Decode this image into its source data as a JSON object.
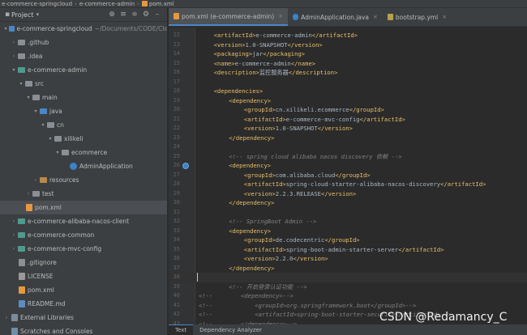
{
  "breadcrumb": {
    "project": "e-commerce-springcloud",
    "module": "e-commerce-admin",
    "file": "pom.xml"
  },
  "project_panel": {
    "title": "Project",
    "tree": [
      {
        "label": "e-commerce-springcloud",
        "extra": "~/Documents/CODE/Clo",
        "indent": 0,
        "arrow": "▾",
        "icon": "fold blue"
      },
      {
        "label": ".github",
        "indent": 1,
        "arrow": "›",
        "icon": "fold grey"
      },
      {
        "label": ".idea",
        "indent": 1,
        "arrow": "›",
        "icon": "fold grey"
      },
      {
        "label": "e-commerce-admin",
        "indent": 1,
        "arrow": "▾",
        "icon": "fold teal"
      },
      {
        "label": "src",
        "indent": 2,
        "arrow": "▾",
        "icon": "fold grey"
      },
      {
        "label": "main",
        "indent": 3,
        "arrow": "▾",
        "icon": "fold grey"
      },
      {
        "label": "java",
        "indent": 4,
        "arrow": "▾",
        "icon": "fold src"
      },
      {
        "label": "cn",
        "indent": 5,
        "arrow": "▾",
        "icon": "fold grey"
      },
      {
        "label": "xilikeli",
        "indent": 6,
        "arrow": "▾",
        "icon": "fold grey"
      },
      {
        "label": "ecommerce",
        "indent": 7,
        "arrow": "▾",
        "icon": "fold grey"
      },
      {
        "label": "AdminApplication",
        "indent": 8,
        "arrow": "",
        "icon": "filei cls"
      },
      {
        "label": "resources",
        "indent": 4,
        "arrow": "›",
        "icon": "fold orange"
      },
      {
        "label": "test",
        "indent": 3,
        "arrow": "›",
        "icon": "fold grey"
      },
      {
        "label": "pom.xml",
        "indent": 2,
        "arrow": "",
        "icon": "filei m",
        "selected": true
      },
      {
        "label": "e-commerce-alibaba-nacos-client",
        "indent": 1,
        "arrow": "›",
        "icon": "fold teal"
      },
      {
        "label": "e-commerce-common",
        "indent": 1,
        "arrow": "›",
        "icon": "fold teal"
      },
      {
        "label": "e-commerce-mvc-config",
        "indent": 1,
        "arrow": "›",
        "icon": "fold teal"
      },
      {
        "label": ".gitignore",
        "indent": 1,
        "arrow": "",
        "icon": "filei git"
      },
      {
        "label": "LICENSE",
        "indent": 1,
        "arrow": "",
        "icon": "filei lic"
      },
      {
        "label": "pom.xml",
        "indent": 1,
        "arrow": "",
        "icon": "filei m"
      },
      {
        "label": "README.md",
        "indent": 1,
        "arrow": "",
        "icon": "filei md"
      },
      {
        "label": "External Libraries",
        "indent": 0,
        "arrow": "›",
        "icon": "filei lib"
      },
      {
        "label": "Scratches and Consoles",
        "indent": 0,
        "arrow": "",
        "icon": "filei scr"
      }
    ]
  },
  "tabs": [
    {
      "label": "pom.xml (e-commerce-admin)",
      "icon": "m",
      "active": true
    },
    {
      "label": "AdminApplication.java",
      "icon": "j",
      "active": false
    },
    {
      "label": "bootstrap.yml",
      "icon": "y",
      "active": false
    }
  ],
  "code_lines": [
    {
      "n": "12",
      "indent": 2,
      "parts": [
        [
          "tag",
          "<artifactId>"
        ],
        [
          "txt",
          "e-commerce-admin"
        ],
        [
          "tag",
          "</artifactId>"
        ]
      ]
    },
    {
      "n": "13",
      "indent": 2,
      "parts": [
        [
          "tag",
          "<version>"
        ],
        [
          "txt",
          "1.0-SNAPSHOT"
        ],
        [
          "tag",
          "</version>"
        ]
      ]
    },
    {
      "n": "14",
      "indent": 2,
      "parts": [
        [
          "tag",
          "<packaging>"
        ],
        [
          "txt",
          "jar"
        ],
        [
          "tag",
          "</packaging>"
        ]
      ]
    },
    {
      "n": "15",
      "indent": 2,
      "parts": [
        [
          "tag",
          "<name>"
        ],
        [
          "txt",
          "e-commerce-admin"
        ],
        [
          "tag",
          "</name>"
        ]
      ]
    },
    {
      "n": "16",
      "indent": 2,
      "parts": [
        [
          "tag",
          "<description>"
        ],
        [
          "txt",
          "监控服务器"
        ],
        [
          "tag",
          "</description>"
        ]
      ]
    },
    {
      "n": "17",
      "indent": 0,
      "parts": []
    },
    {
      "n": "18",
      "indent": 2,
      "parts": [
        [
          "tag",
          "<dependencies>"
        ]
      ]
    },
    {
      "n": "19",
      "indent": 4,
      "parts": [
        [
          "tag",
          "<dependency>"
        ]
      ]
    },
    {
      "n": "20",
      "indent": 6,
      "parts": [
        [
          "tag",
          "<groupId>"
        ],
        [
          "txt",
          "cn.xilikeli.ecommerce"
        ],
        [
          "tag",
          "</groupId>"
        ]
      ]
    },
    {
      "n": "21",
      "indent": 6,
      "parts": [
        [
          "tag",
          "<artifactId>"
        ],
        [
          "txt",
          "e-commerce-mvc-config"
        ],
        [
          "tag",
          "</artifactId>"
        ]
      ]
    },
    {
      "n": "22",
      "indent": 6,
      "parts": [
        [
          "tag",
          "<version>"
        ],
        [
          "txt",
          "1.0-SNAPSHOT"
        ],
        [
          "tag",
          "</version>"
        ]
      ]
    },
    {
      "n": "23",
      "indent": 4,
      "parts": [
        [
          "tag",
          "</dependency>"
        ]
      ]
    },
    {
      "n": "24",
      "indent": 0,
      "parts": []
    },
    {
      "n": "25",
      "indent": 4,
      "parts": [
        [
          "cmt",
          "<!-- spring cloud alibaba nacos discovery 依赖 -->"
        ]
      ]
    },
    {
      "n": "26",
      "indent": 4,
      "parts": [
        [
          "tag",
          "<dependency>"
        ]
      ],
      "marker": true
    },
    {
      "n": "27",
      "indent": 6,
      "parts": [
        [
          "tag",
          "<groupId>"
        ],
        [
          "txt",
          "com.alibaba.cloud"
        ],
        [
          "tag",
          "</groupId>"
        ]
      ]
    },
    {
      "n": "28",
      "indent": 6,
      "parts": [
        [
          "tag",
          "<artifactId>"
        ],
        [
          "txt",
          "spring-cloud-starter-alibaba-nacos-discovery"
        ],
        [
          "tag",
          "</artifactId>"
        ]
      ]
    },
    {
      "n": "29",
      "indent": 6,
      "parts": [
        [
          "tag",
          "<version>"
        ],
        [
          "txt",
          "2.2.3.RELEASE"
        ],
        [
          "tag",
          "</version>"
        ]
      ]
    },
    {
      "n": "30",
      "indent": 4,
      "parts": [
        [
          "tag",
          "</dependency>"
        ]
      ]
    },
    {
      "n": "31",
      "indent": 0,
      "parts": []
    },
    {
      "n": "32",
      "indent": 4,
      "parts": [
        [
          "cmt",
          "<!-- SpringBoot Admin -->"
        ]
      ]
    },
    {
      "n": "33",
      "indent": 4,
      "parts": [
        [
          "tag",
          "<dependency>"
        ]
      ]
    },
    {
      "n": "34",
      "indent": 6,
      "parts": [
        [
          "tag",
          "<groupId>"
        ],
        [
          "txt",
          "de.codecentric"
        ],
        [
          "tag",
          "</groupId>"
        ]
      ]
    },
    {
      "n": "35",
      "indent": 6,
      "parts": [
        [
          "tag",
          "<artifactId>"
        ],
        [
          "txt",
          "spring-boot-admin-starter-server"
        ],
        [
          "tag",
          "</artifactId>"
        ]
      ]
    },
    {
      "n": "36",
      "indent": 6,
      "parts": [
        [
          "tag",
          "<version>"
        ],
        [
          "txt",
          "2.2.0"
        ],
        [
          "tag",
          "</version>"
        ]
      ]
    },
    {
      "n": "37",
      "indent": 4,
      "parts": [
        [
          "tag",
          "</dependency>"
        ]
      ]
    },
    {
      "n": "38",
      "indent": 0,
      "parts": [],
      "current": true
    },
    {
      "n": "39",
      "indent": 4,
      "parts": [
        [
          "cmt",
          "<!-- 开启登录认证功能 -->"
        ]
      ]
    },
    {
      "n": "40",
      "indent": 0,
      "parts": [
        [
          "cmt",
          "<!--        <dependency>-->"
        ]
      ]
    },
    {
      "n": "41",
      "indent": 0,
      "parts": [
        [
          "cmt",
          "<!--            <groupId>org.springframework.boot</groupId>-->"
        ]
      ]
    },
    {
      "n": "42",
      "indent": 0,
      "parts": [
        [
          "cmt",
          "<!--            <artifactId>spring-boot-starter-security</artifactId>-->"
        ]
      ]
    },
    {
      "n": "43",
      "indent": 0,
      "parts": [
        [
          "cmt",
          "<!--        </dependency>-->"
        ]
      ]
    }
  ],
  "bottom_tabs": [
    {
      "label": "Text",
      "active": true
    },
    {
      "label": "Dependency Analyzer",
      "active": false
    }
  ],
  "watermark": "CSDN @Redamancy_C",
  "annotation": {
    "color": "#e03030"
  }
}
